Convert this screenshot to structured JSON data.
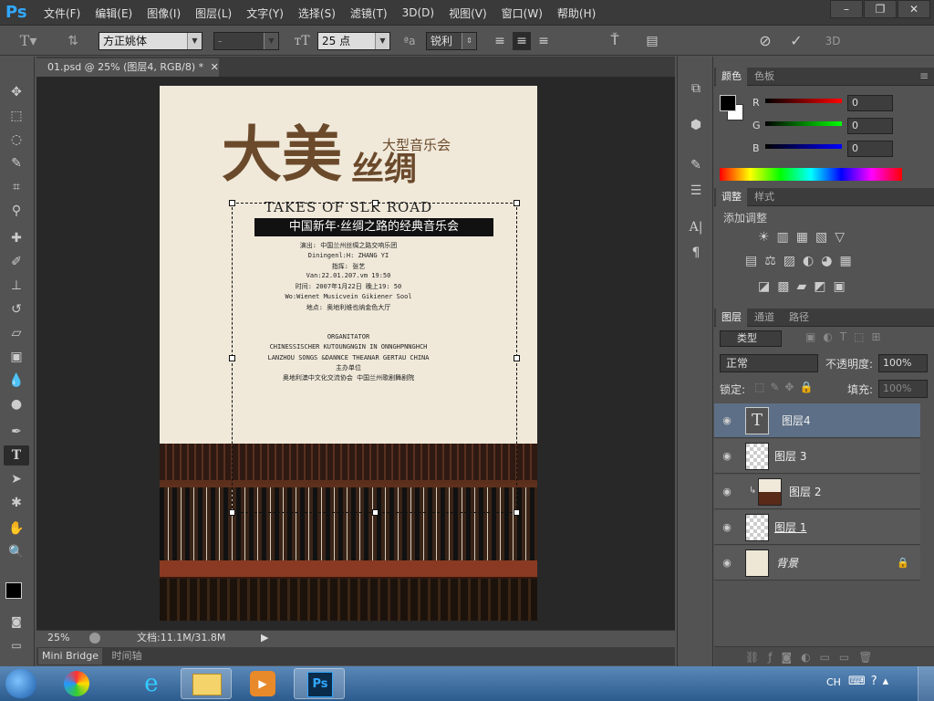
{
  "app": {
    "logo": "Ps"
  },
  "menu": [
    "文件(F)",
    "编辑(E)",
    "图像(I)",
    "图层(L)",
    "文字(Y)",
    "选择(S)",
    "滤镜(T)",
    "3D(D)",
    "视图(V)",
    "窗口(W)",
    "帮助(H)"
  ],
  "options": {
    "font_family": "方正姚体",
    "font_style": "-",
    "font_size": "25 点",
    "antialias": "锐利",
    "color": "#000000"
  },
  "document": {
    "tab_title": "01.psd @ 25% (图层4, RGB/8) *"
  },
  "poster": {
    "cn_subtitle": "大型音乐会",
    "calligraphy_big": "大美",
    "calligraphy_small": "丝绸",
    "en_title": "TAKES OF SLK ROAD",
    "cn_banner": "中国新年·丝绸之路的经典音乐会",
    "lines": [
      "演出: 中国兰州丝绸之路交响乐团",
      "Diningenl:H: ZHANG YI",
      "指挥: 张艺",
      "Van:22.01.207.vm 19:50",
      "时间: 2007年1月22日 晚上19: 50",
      "Wo:Wienet Musicvein Gikiener Sool",
      "地点: 奥地利维也纳金色大厅"
    ],
    "org_lines": [
      "ORGANITATOR",
      "CHINESSISCHER KUTOUNGNGIN IN ONNGHPNNGHCH",
      "LANZHOU SONGS &DANNCE THEANAR GERTAU CHINA",
      "主办单位",
      "奥地利澳中文化交流协会   中国兰州歌剧舞剧院"
    ]
  },
  "status": {
    "zoom": "25%",
    "doc": "文档:11.1M/31.8M"
  },
  "bottom_tabs": [
    "Mini Bridge",
    "时间轴"
  ],
  "color_panel": {
    "tabs": [
      "颜色",
      "色板"
    ],
    "channels": [
      {
        "name": "R",
        "value": "0"
      },
      {
        "name": "G",
        "value": "0"
      },
      {
        "name": "B",
        "value": "0"
      }
    ],
    "foreground": "#000000",
    "background": "#ffffff"
  },
  "adjust_panel": {
    "tabs": [
      "调整",
      "样式"
    ],
    "title": "添加调整"
  },
  "layers_panel": {
    "tabs": [
      "图层",
      "通道",
      "路径"
    ],
    "filter": "类型",
    "blend": "正常",
    "opacity_label": "不透明度:",
    "opacity": "100%",
    "lock_label": "锁定:",
    "fill_label": "填充:",
    "fill": "100%",
    "layers": [
      {
        "name": "图层4"
      },
      {
        "name": "图层 3"
      },
      {
        "name": "图层 2"
      },
      {
        "name": "图层 1"
      },
      {
        "name": "背景"
      }
    ]
  },
  "taskbar": {
    "ime": "CH"
  }
}
